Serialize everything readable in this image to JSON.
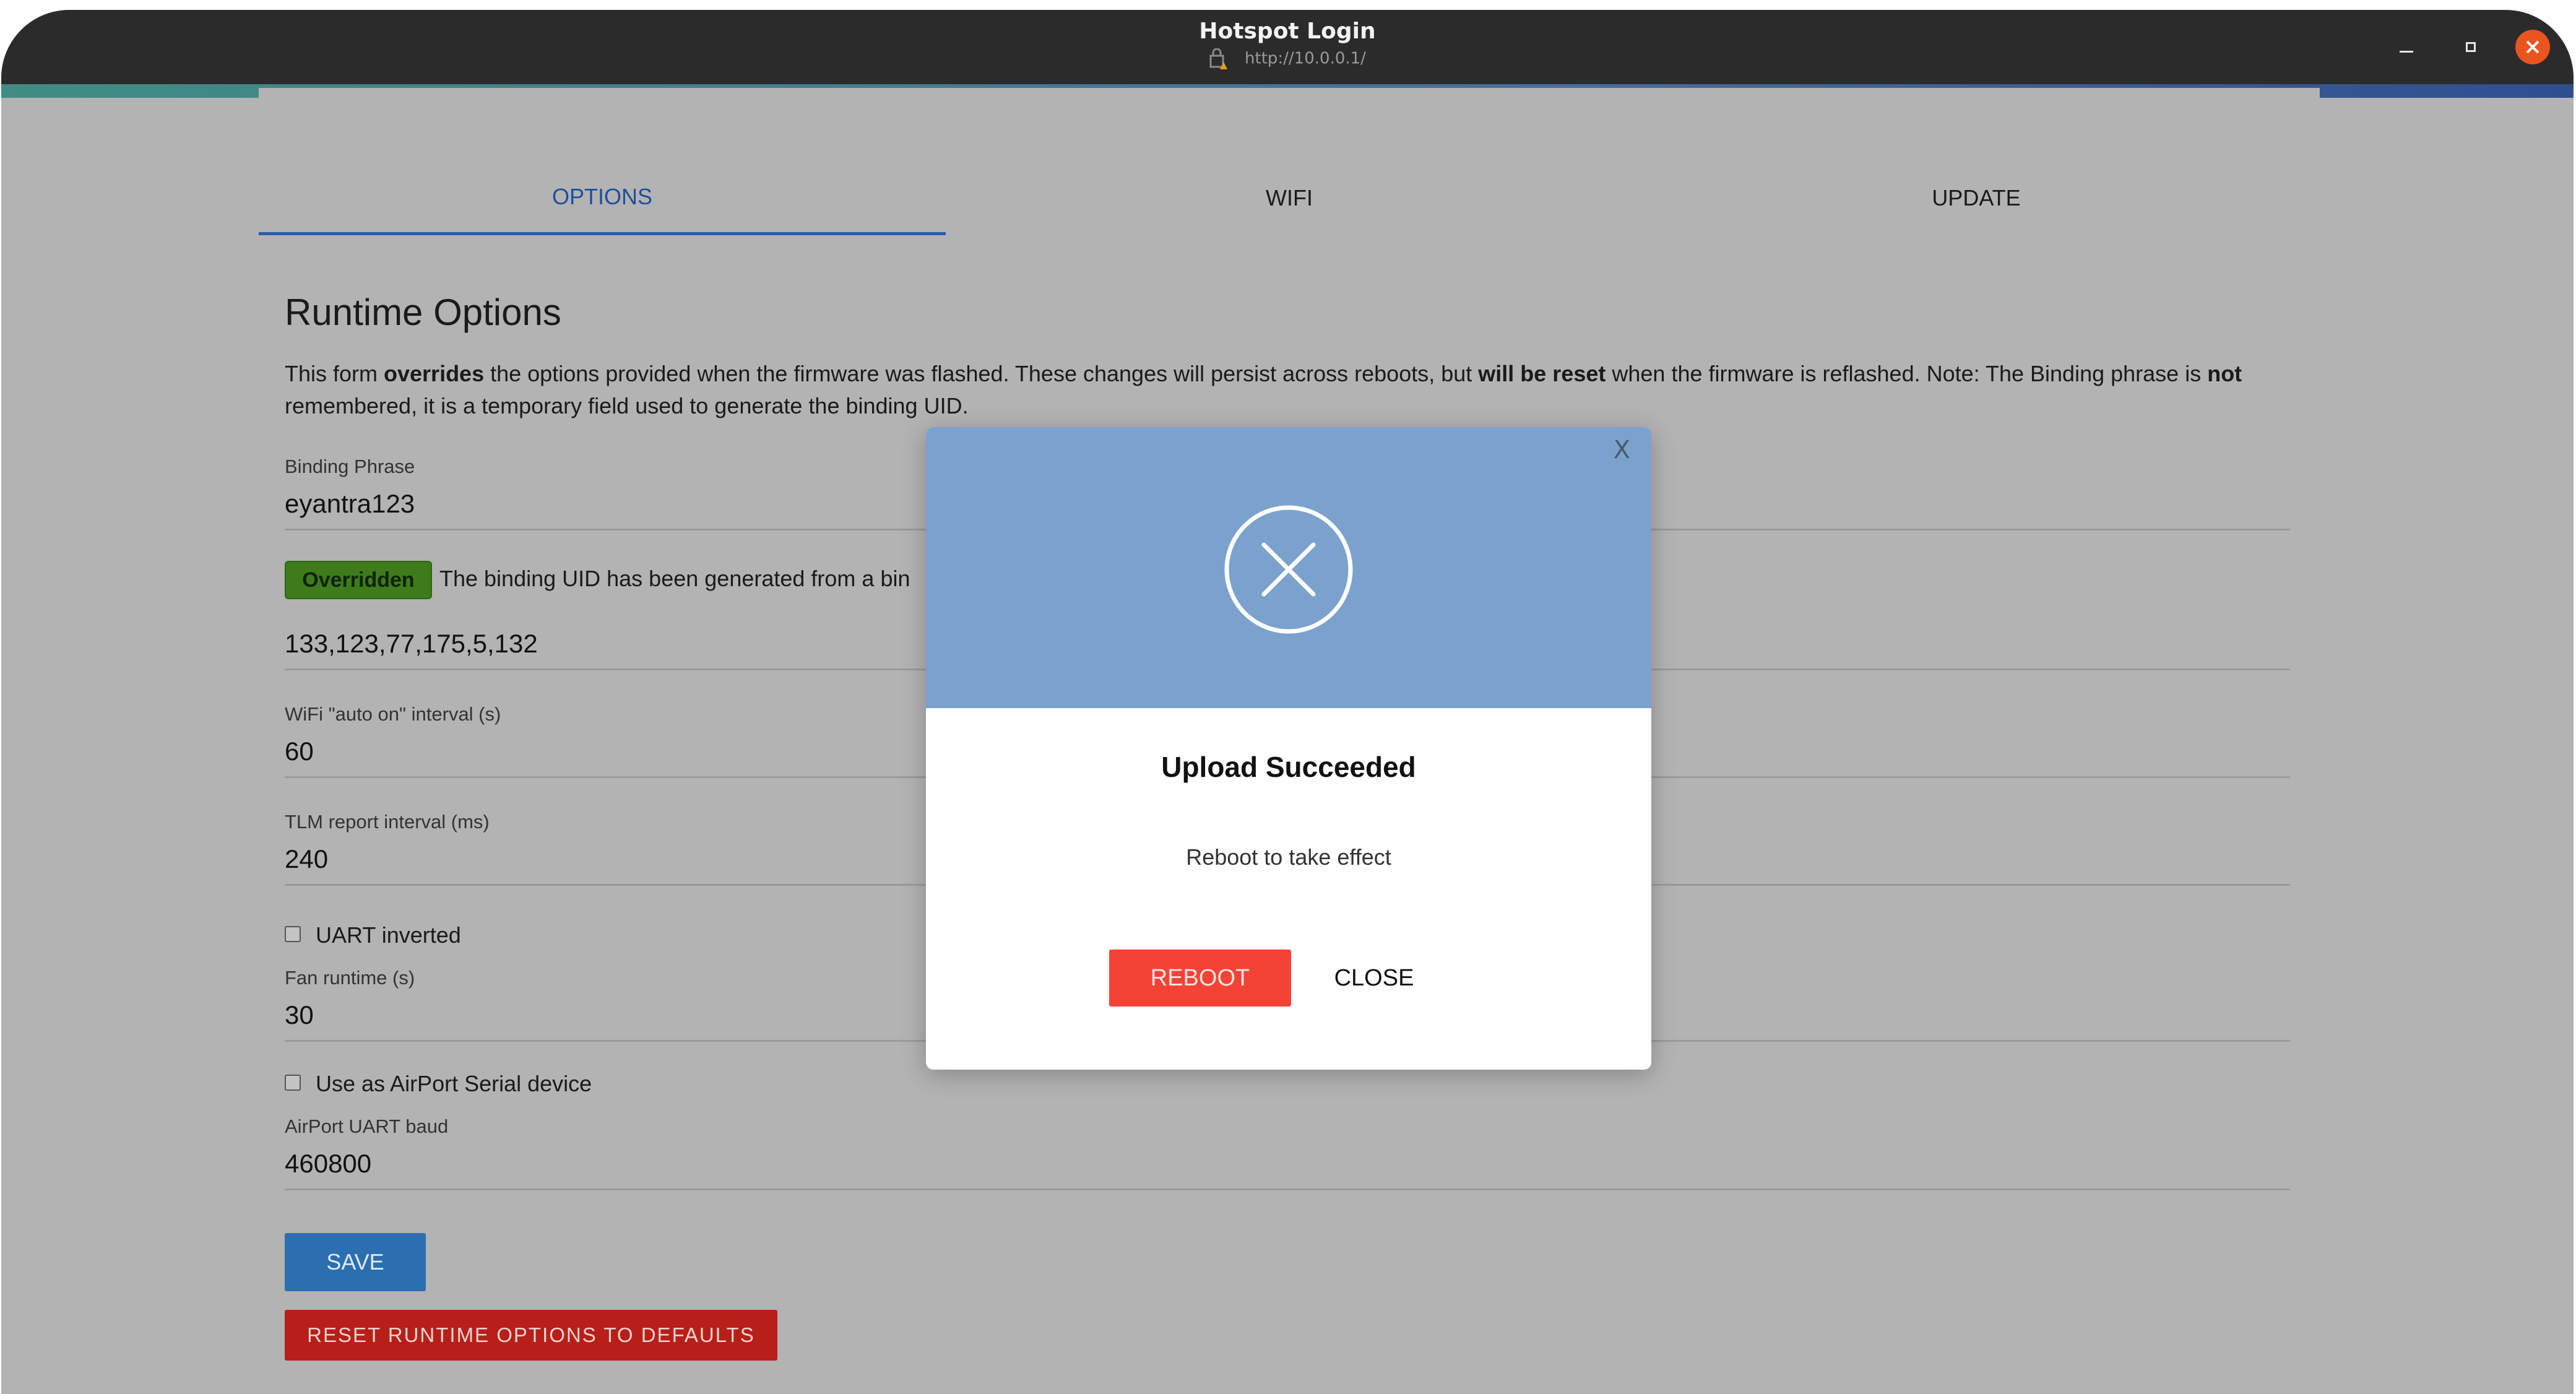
{
  "window": {
    "title": "Hotspot Login",
    "url": "http://10.0.0.1/"
  },
  "tabs": [
    {
      "label": "OPTIONS",
      "active": true
    },
    {
      "label": "WIFI",
      "active": false
    },
    {
      "label": "UPDATE",
      "active": false
    }
  ],
  "page": {
    "heading": "Runtime Options",
    "desc": {
      "p1": "This form ",
      "b1": "overrides",
      "p2": " the options provided when the firmware was flashed. These changes will persist across reboots, but ",
      "b2": "will be reset",
      "p3": " when the firmware is reflashed. Note: The Binding phrase is ",
      "b3": "not",
      "p4": " remembered, it is a temporary field used to generate the binding UID."
    }
  },
  "form": {
    "binding_phrase": {
      "label": "Binding Phrase",
      "value": "eyantra123"
    },
    "overridden_badge": "Overridden",
    "overridden_text": "The binding UID has been generated from a bin",
    "uid_value": "133,123,77,175,5,132",
    "wifi_interval": {
      "label": "WiFi \"auto on\" interval (s)",
      "value": "60"
    },
    "tlm_interval": {
      "label": "TLM report interval (ms)",
      "value": "240"
    },
    "uart_inverted": {
      "label": "UART inverted",
      "checked": false
    },
    "fan_runtime": {
      "label": "Fan runtime (s)",
      "value": "30"
    },
    "airport_serial": {
      "label": "Use as AirPort Serial device",
      "checked": false
    },
    "airport_baud": {
      "label": "AirPort UART baud",
      "value": "460800"
    },
    "save_label": "SAVE",
    "reset_label": "RESET RUNTIME OPTIONS TO DEFAULTS"
  },
  "modal": {
    "close_x": "X",
    "title": "Upload Succeeded",
    "message": "Reboot to take effect",
    "reboot_label": "REBOOT",
    "close_label": "CLOSE",
    "icon": "x-circle-icon",
    "header_color": "#7ba2cd",
    "reboot_color": "#f44336"
  },
  "colors": {
    "accent": "#2a5da8",
    "save": "#2c6fb0",
    "reset": "#b71f18",
    "badge": "#3e7b1b"
  }
}
